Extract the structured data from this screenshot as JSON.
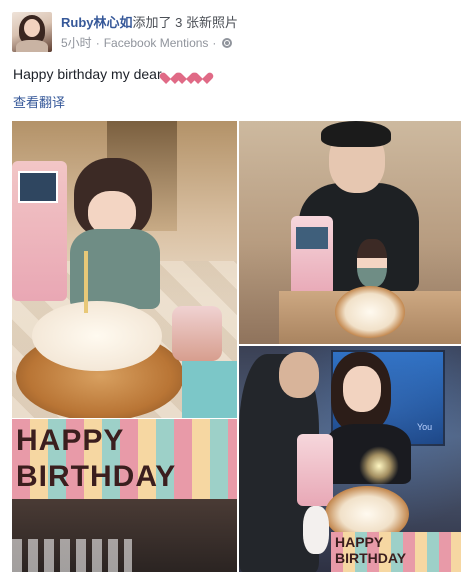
{
  "post": {
    "author": "Ruby林心如",
    "action": "添加了 3 张新照片",
    "time": "5小时",
    "separator": "·",
    "source": "Facebook Mentions",
    "privacy_icon": "globe-icon",
    "message": "Happy birthday my dear",
    "hearts": [
      "pink-heart-icon",
      "pink-heart-icon",
      "pink-heart-icon"
    ],
    "translate_link": "查看翻译"
  },
  "photos": {
    "p2_banner_line1": "HAPPY",
    "p2_banner_line2": "BIRTHDAY",
    "p4_banner_line1": "HAPPY",
    "p4_banner_line2": "BIRTHDAY",
    "p4_tv_text": "You"
  },
  "colors": {
    "link": "#365899",
    "meta": "#90949c",
    "heart": "#e06a86"
  }
}
